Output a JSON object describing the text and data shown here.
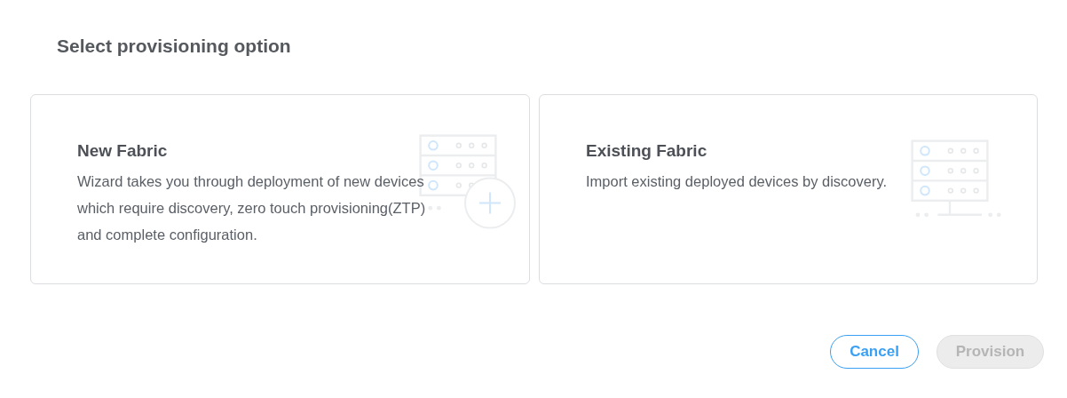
{
  "title": "Select provisioning option",
  "options": [
    {
      "kind": "new",
      "title": "New Fabric",
      "description": "Wizard takes you through deployment of new devices which require discovery, zero touch provisioning(ZTP) and complete configuration.",
      "selected": false
    },
    {
      "kind": "existing",
      "title": "Existing Fabric",
      "description": "Import existing deployed devices by discovery.",
      "selected": false
    }
  ],
  "buttons": [
    {
      "label": "Cancel",
      "kind": "secondary",
      "disabled": false
    },
    {
      "label": "Provision",
      "kind": "primary",
      "disabled": true
    }
  ]
}
